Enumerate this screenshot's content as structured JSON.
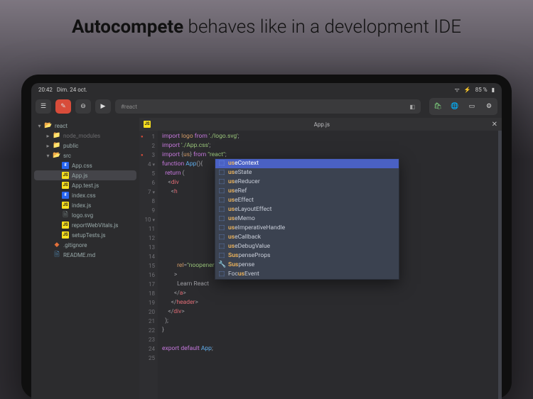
{
  "headline": {
    "bold": "Autocompete",
    "rest": " behaves like in a development IDE"
  },
  "statusbar": {
    "time": "20:42",
    "date": "Dim. 24 oct.",
    "battery": "85 %",
    "wifi": "wifi",
    "charge": "⚡"
  },
  "toolbar": {
    "addr_text": "#react",
    "icons": {
      "sidebar": "▤",
      "shell": "⦿",
      "minus": "⊖",
      "play": "▶",
      "book": "☰",
      "store": "🛍",
      "globe": "🌐",
      "rect": "▭",
      "gear": "⚙"
    }
  },
  "sidebar": {
    "nodes": [
      {
        "name": "react",
        "icon": "folder-open",
        "indent": 0,
        "tw": "▾"
      },
      {
        "name": "node_modules",
        "icon": "folder",
        "indent": 1,
        "tw": "▸",
        "dim": true
      },
      {
        "name": "public",
        "icon": "folder",
        "indent": 1,
        "tw": "▸"
      },
      {
        "name": "src",
        "icon": "folder-open",
        "indent": 1,
        "tw": "▾"
      },
      {
        "name": "App.css",
        "icon": "css",
        "indent": 2
      },
      {
        "name": "App.js",
        "icon": "js",
        "indent": 2,
        "sel": true
      },
      {
        "name": "App.test.js",
        "icon": "js",
        "indent": 2
      },
      {
        "name": "index.css",
        "icon": "css",
        "indent": 2
      },
      {
        "name": "index.js",
        "icon": "js",
        "indent": 2
      },
      {
        "name": "logo.svg",
        "icon": "file",
        "indent": 2
      },
      {
        "name": "reportWebVitals.js",
        "icon": "js",
        "indent": 2
      },
      {
        "name": "setupTests.js",
        "icon": "js",
        "indent": 2
      },
      {
        "name": ".gitignore",
        "icon": "git",
        "indent": 1
      },
      {
        "name": "README.md",
        "icon": "md",
        "indent": 1
      }
    ]
  },
  "tab": {
    "file": "App.js"
  },
  "gutter": [
    {
      "n": 1,
      "mark": "err"
    },
    {
      "n": 2
    },
    {
      "n": 3,
      "mark": "err"
    },
    {
      "n": 4,
      "mark": "arrd"
    },
    {
      "n": 5
    },
    {
      "n": 6
    },
    {
      "n": 7,
      "mark": "arrd"
    },
    {
      "n": 8
    },
    {
      "n": 9
    },
    {
      "n": 10,
      "mark": "arrd"
    },
    {
      "n": 11
    },
    {
      "n": 12
    },
    {
      "n": 13
    },
    {
      "n": 14
    },
    {
      "n": 15
    },
    {
      "n": 16
    },
    {
      "n": 17
    },
    {
      "n": 18
    },
    {
      "n": 19
    },
    {
      "n": 20
    },
    {
      "n": 21
    },
    {
      "n": 22
    },
    {
      "n": 23
    },
    {
      "n": 24
    },
    {
      "n": 25
    }
  ],
  "code": [
    "<span class='kw'>import</span> <span class='id'>logo</span> <span class='kw'>from</span> <span class='str'>'./logo.svg'</span>;",
    "<span class='kw'>import</span> <span class='str'>'./App.css'</span>;",
    "<span class='kw'>import</span> {<span class='id'>us</span>} <span class='kw'>from</span> <span class='str'>\"react\"</span>;",
    "<span class='kw'>function</span> <span class='fn'>App</span>(){",
    "  <span class='kw'>return</span> (",
    "    &lt;<span class='tag'>div</span>",
    "      &lt;<span class='tag'>h</span>",
    "",
    "",
    "",
    "",
    "",
    "",
    "",
    "          <span class='attr'>rel</span>=<span class='str'>\"noopener noreferrer\"</span>",
    "        &gt;",
    "          Learn React",
    "        &lt;/<span class='tag'>a</span>&gt;",
    "      &lt;/<span class='tag'>header</span>&gt;",
    "    &lt;/<span class='tag'>div</span>&gt;",
    "  );",
    "}",
    "",
    "<span class='kw'>export</span> <span class='kw'>default</span> <span class='fn'>App</span>;",
    ""
  ],
  "autocomplete": [
    {
      "icon": "cube",
      "pre": "us",
      "text": "eContext",
      "sel": true
    },
    {
      "icon": "cube",
      "pre": "us",
      "text": "eState"
    },
    {
      "icon": "cube",
      "pre": "us",
      "text": "eReducer"
    },
    {
      "icon": "cube",
      "pre": "us",
      "text": "eRef"
    },
    {
      "icon": "cube",
      "pre": "us",
      "text": "eEffect"
    },
    {
      "icon": "cube",
      "pre": "us",
      "text": "eLayoutEffect"
    },
    {
      "icon": "cube",
      "pre": "us",
      "text": "eMemo"
    },
    {
      "icon": "cube",
      "pre": "us",
      "text": "eImperativeHandle"
    },
    {
      "icon": "cube",
      "pre": "us",
      "text": "eCallback"
    },
    {
      "icon": "cube",
      "pre": "us",
      "text": "eDebugValue"
    },
    {
      "icon": "cube",
      "pre": "Sus",
      "text": "penseProps"
    },
    {
      "icon": "wrench",
      "pre": "Sus",
      "text": "pense"
    },
    {
      "icon": "cube",
      "pre": "",
      "match2": "us",
      "text": "Event",
      "prefix": "Foc"
    }
  ]
}
